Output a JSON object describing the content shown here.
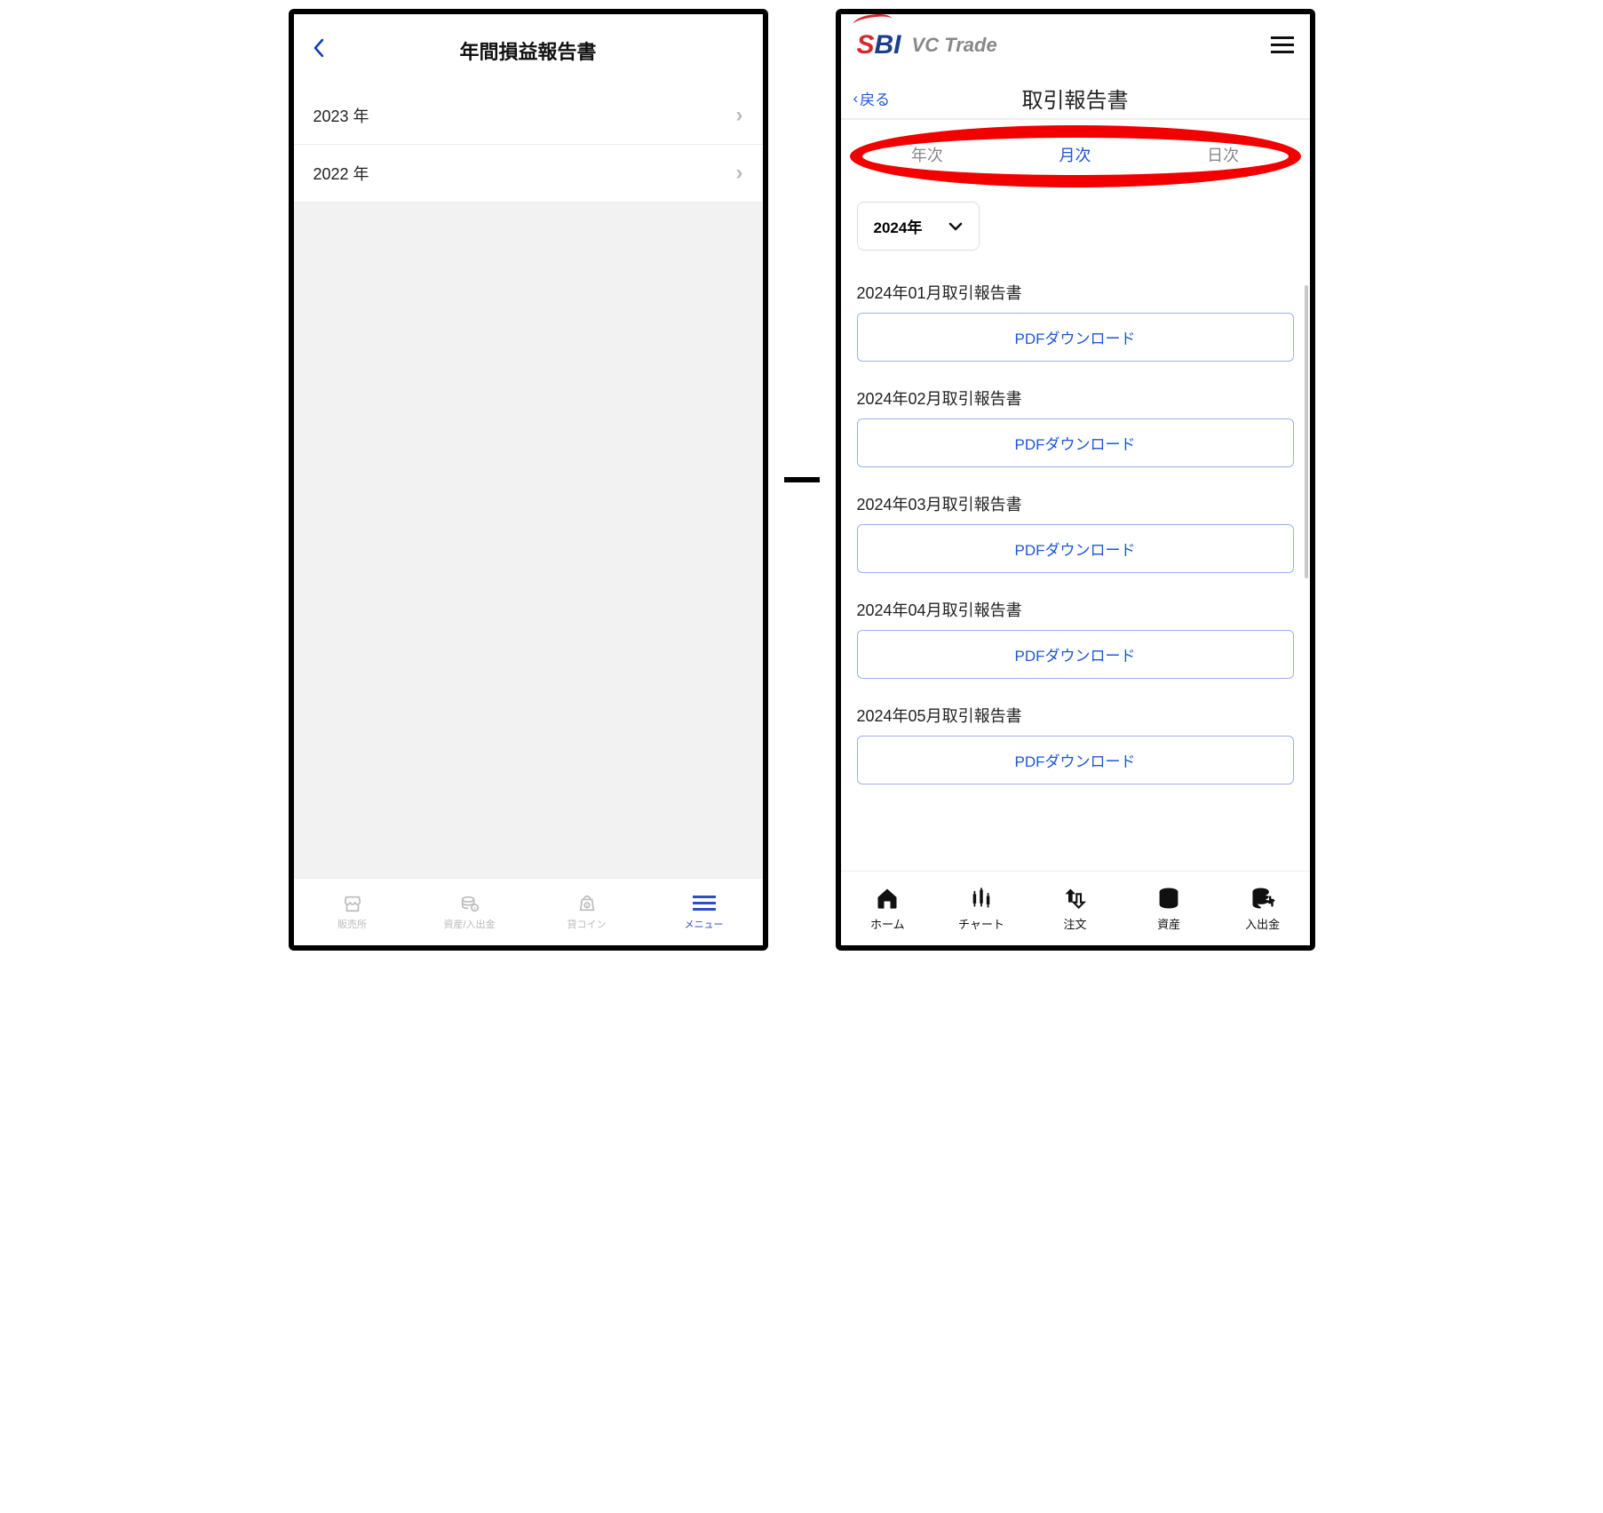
{
  "left": {
    "title": "年間損益報告書",
    "rows": [
      {
        "label": "2023 年"
      },
      {
        "label": "2022 年"
      }
    ],
    "tabs": [
      {
        "label": "販売所"
      },
      {
        "label": "資産/入出金"
      },
      {
        "label": "貸コイン"
      },
      {
        "label": "メニュー"
      }
    ]
  },
  "right": {
    "logo_brand": "SBI",
    "logo_sub": "VC Trade",
    "back_label": "戻る",
    "title": "取引報告書",
    "tabs": [
      {
        "label": "年次"
      },
      {
        "label": "月次"
      },
      {
        "label": "日次"
      }
    ],
    "year_selected": "2024年",
    "dl_label": "PDFダウンロード",
    "reports": [
      {
        "label": "2024年01月取引報告書"
      },
      {
        "label": "2024年02月取引報告書"
      },
      {
        "label": "2024年03月取引報告書"
      },
      {
        "label": "2024年04月取引報告書"
      },
      {
        "label": "2024年05月取引報告書"
      }
    ],
    "nav": [
      {
        "label": "ホーム"
      },
      {
        "label": "チャート"
      },
      {
        "label": "注文"
      },
      {
        "label": "資産"
      },
      {
        "label": "入出金"
      }
    ]
  }
}
